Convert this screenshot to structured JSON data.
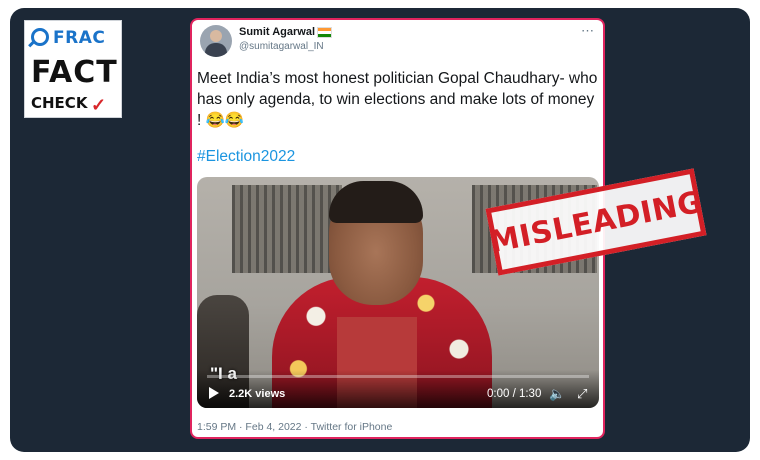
{
  "logo": {
    "brand": "FRAC",
    "line1": "FACT",
    "line2": "CHECK"
  },
  "tweet": {
    "author_name": "Sumit Agarwal",
    "handle": "@sumitagarwal_IN",
    "more_icon": "⋯",
    "text": "Meet India’s most honest politician Gopal Chaudhary- who has only agenda, to win elections and make lots of money ! 😂😂",
    "hashtag": "#Election2022",
    "footer": "1:59 PM · Feb 4, 2022 · Twitter for iPhone"
  },
  "video": {
    "subtitle": "\"I a",
    "views": "2.2K views",
    "time": "0:00 / 1:30",
    "progress": 0.0,
    "icons": [
      "play-icon",
      "volume-icon",
      "expand-icon"
    ]
  },
  "stamp": {
    "label": "MISLEADING"
  },
  "colors": {
    "panel": "#1c2836",
    "accent": "#d31f26",
    "hashtag": "#1b95e0",
    "frac_blue": "#1a73c9"
  }
}
